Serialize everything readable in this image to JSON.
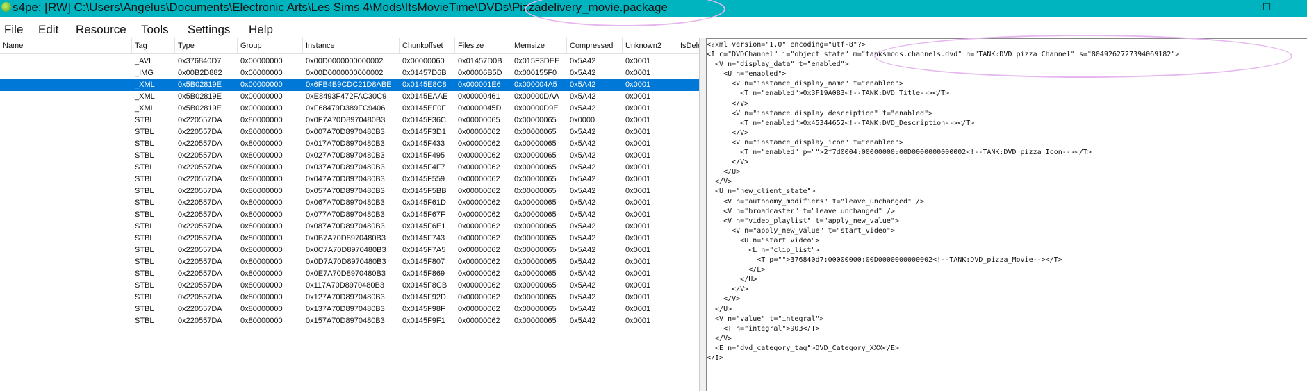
{
  "window": {
    "title": "s4pe: [RW] C:\\Users\\Angelus\\Documents\\Electronic Arts\\Les Sims 4\\Mods\\ItsMovieTime\\DVDs\\Pizzadelivery_movie.package",
    "minimize_glyph": "—",
    "maximize_glyph": "☐"
  },
  "menu": [
    "File",
    "Edit",
    "Resource",
    "Tools",
    "Settings",
    "Help"
  ],
  "grid": {
    "columns": [
      "Name",
      "Tag",
      "Type",
      "Group",
      "Instance",
      "Chunkoffset",
      "Filesize",
      "Memsize",
      "Compressed",
      "Unknown2",
      "IsDele"
    ],
    "selected_index": 2,
    "rows": [
      [
        "",
        "_AVI",
        "0x376840D7",
        "0x00000000",
        "0x00D0000000000002",
        "0x00000060",
        "0x01457D0B",
        "0x015F3DEE",
        "0x5A42",
        "0x0001",
        ""
      ],
      [
        "",
        "_IMG",
        "0x00B2D882",
        "0x00000000",
        "0x00D0000000000002",
        "0x01457D6B",
        "0x00006B5D",
        "0x000155F0",
        "0x5A42",
        "0x0001",
        ""
      ],
      [
        "",
        "_XML",
        "0x5B02819E",
        "0x00000000",
        "0x6FB4B9CDC21D8ABE",
        "0x0145E8C8",
        "0x000001E6",
        "0x000004A5",
        "0x5A42",
        "0x0001",
        ""
      ],
      [
        "",
        "_XML",
        "0x5B02819E",
        "0x00000000",
        "0xE8493F472FAC30C9",
        "0x0145EAAE",
        "0x00000461",
        "0x00000DAA",
        "0x5A42",
        "0x0001",
        ""
      ],
      [
        "",
        "_XML",
        "0x5B02819E",
        "0x00000000",
        "0xF68479D389FC9406",
        "0x0145EF0F",
        "0x0000045D",
        "0x00000D9E",
        "0x5A42",
        "0x0001",
        ""
      ],
      [
        "",
        "STBL",
        "0x220557DA",
        "0x80000000",
        "0x0F7A70D8970480B3",
        "0x0145F36C",
        "0x00000065",
        "0x00000065",
        "0x0000",
        "0x0001",
        ""
      ],
      [
        "",
        "STBL",
        "0x220557DA",
        "0x80000000",
        "0x007A70D8970480B3",
        "0x0145F3D1",
        "0x00000062",
        "0x00000065",
        "0x5A42",
        "0x0001",
        ""
      ],
      [
        "",
        "STBL",
        "0x220557DA",
        "0x80000000",
        "0x017A70D8970480B3",
        "0x0145F433",
        "0x00000062",
        "0x00000065",
        "0x5A42",
        "0x0001",
        ""
      ],
      [
        "",
        "STBL",
        "0x220557DA",
        "0x80000000",
        "0x027A70D8970480B3",
        "0x0145F495",
        "0x00000062",
        "0x00000065",
        "0x5A42",
        "0x0001",
        ""
      ],
      [
        "",
        "STBL",
        "0x220557DA",
        "0x80000000",
        "0x037A70D8970480B3",
        "0x0145F4F7",
        "0x00000062",
        "0x00000065",
        "0x5A42",
        "0x0001",
        ""
      ],
      [
        "",
        "STBL",
        "0x220557DA",
        "0x80000000",
        "0x047A70D8970480B3",
        "0x0145F559",
        "0x00000062",
        "0x00000065",
        "0x5A42",
        "0x0001",
        ""
      ],
      [
        "",
        "STBL",
        "0x220557DA",
        "0x80000000",
        "0x057A70D8970480B3",
        "0x0145F5BB",
        "0x00000062",
        "0x00000065",
        "0x5A42",
        "0x0001",
        ""
      ],
      [
        "",
        "STBL",
        "0x220557DA",
        "0x80000000",
        "0x067A70D8970480B3",
        "0x0145F61D",
        "0x00000062",
        "0x00000065",
        "0x5A42",
        "0x0001",
        ""
      ],
      [
        "",
        "STBL",
        "0x220557DA",
        "0x80000000",
        "0x077A70D8970480B3",
        "0x0145F67F",
        "0x00000062",
        "0x00000065",
        "0x5A42",
        "0x0001",
        ""
      ],
      [
        "",
        "STBL",
        "0x220557DA",
        "0x80000000",
        "0x087A70D8970480B3",
        "0x0145F6E1",
        "0x00000062",
        "0x00000065",
        "0x5A42",
        "0x0001",
        ""
      ],
      [
        "",
        "STBL",
        "0x220557DA",
        "0x80000000",
        "0x0B7A70D8970480B3",
        "0x0145F743",
        "0x00000062",
        "0x00000065",
        "0x5A42",
        "0x0001",
        ""
      ],
      [
        "",
        "STBL",
        "0x220557DA",
        "0x80000000",
        "0x0C7A70D8970480B3",
        "0x0145F7A5",
        "0x00000062",
        "0x00000065",
        "0x5A42",
        "0x0001",
        ""
      ],
      [
        "",
        "STBL",
        "0x220557DA",
        "0x80000000",
        "0x0D7A70D8970480B3",
        "0x0145F807",
        "0x00000062",
        "0x00000065",
        "0x5A42",
        "0x0001",
        ""
      ],
      [
        "",
        "STBL",
        "0x220557DA",
        "0x80000000",
        "0x0E7A70D8970480B3",
        "0x0145F869",
        "0x00000062",
        "0x00000065",
        "0x5A42",
        "0x0001",
        ""
      ],
      [
        "",
        "STBL",
        "0x220557DA",
        "0x80000000",
        "0x117A70D8970480B3",
        "0x0145F8CB",
        "0x00000062",
        "0x00000065",
        "0x5A42",
        "0x0001",
        ""
      ],
      [
        "",
        "STBL",
        "0x220557DA",
        "0x80000000",
        "0x127A70D8970480B3",
        "0x0145F92D",
        "0x00000062",
        "0x00000065",
        "0x5A42",
        "0x0001",
        ""
      ],
      [
        "",
        "STBL",
        "0x220557DA",
        "0x80000000",
        "0x137A70D8970480B3",
        "0x0145F98F",
        "0x00000062",
        "0x00000065",
        "0x5A42",
        "0x0001",
        ""
      ],
      [
        "",
        "STBL",
        "0x220557DA",
        "0x80000000",
        "0x157A70D8970480B3",
        "0x0145F9F1",
        "0x00000062",
        "0x00000065",
        "0x5A42",
        "0x0001",
        ""
      ]
    ]
  },
  "xml_preview": {
    "lines": [
      "<?xml version=\"1.0\" encoding=\"utf-8\"?>",
      "<I c=\"DVDChannel\" i=\"object_state\" m=\"tanksmods.channels.dvd\" n=\"TANK:DVD_pizza_Channel\" s=\"8049262727394069182\">",
      "  <V n=\"display_data\" t=\"enabled\">",
      "    <U n=\"enabled\">",
      "      <V n=\"instance_display_name\" t=\"enabled\">",
      "        <T n=\"enabled\">0x3F19A0B3<!--TANK:DVD_Title--></T>",
      "      </V>",
      "      <V n=\"instance_display_description\" t=\"enabled\">",
      "        <T n=\"enabled\">0x45344652<!--TANK:DVD_Description--></T>",
      "      </V>",
      "      <V n=\"instance_display_icon\" t=\"enabled\">",
      "        <T n=\"enabled\" p=\"\">2f7d0004:00000000:00D0000000000002<!--TANK:DVD_pizza_Icon--></T>",
      "      </V>",
      "    </U>",
      "  </V>",
      "  <U n=\"new_client_state\">",
      "    <V n=\"autonomy_modifiers\" t=\"leave_unchanged\" />",
      "    <V n=\"broadcaster\" t=\"leave_unchanged\" />",
      "    <V n=\"video_playlist\" t=\"apply_new_value\">",
      "      <V n=\"apply_new_value\" t=\"start_video\">",
      "        <U n=\"start_video\">",
      "          <L n=\"clip_list\">",
      "            <T p=\"\">376840d7:00000000:00D0000000000002<!--TANK:DVD_pizza_Movie--></T>",
      "          </L>",
      "        </U>",
      "      </V>",
      "    </V>",
      "  </U>",
      "  <V n=\"value\" t=\"integral\">",
      "    <T n=\"integral\">903</T>",
      "  </V>",
      "  <E n=\"dvd_category_tag\">DVD_Category_XXX</E>",
      "</I>"
    ]
  },
  "colors": {
    "titlebar": "#00b4bf",
    "selection": "#0078d7",
    "annotation": "#e6b7ee"
  }
}
